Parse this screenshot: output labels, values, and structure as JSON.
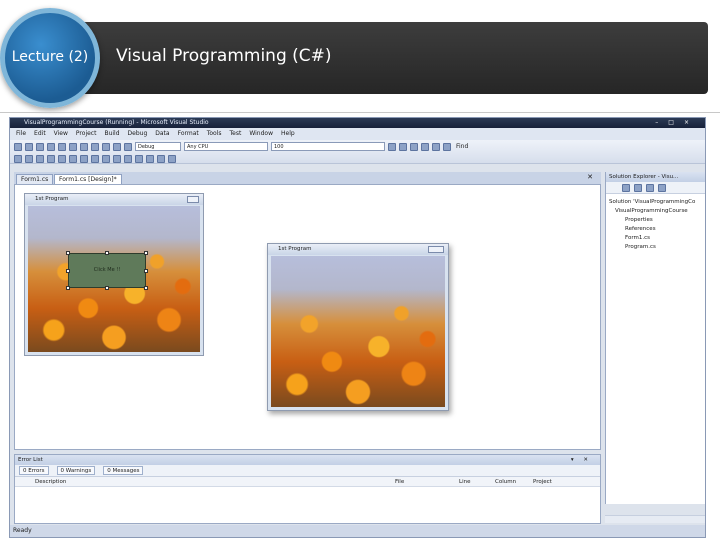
{
  "slide": {
    "lecture_label": "Lecture (2)",
    "title": "Visual Programming (C#)"
  },
  "window": {
    "title": "VisualProgrammingCourse (Running) - Microsoft Visual Studio",
    "controls": "–□×"
  },
  "menu": [
    "File",
    "Edit",
    "View",
    "Project",
    "Build",
    "Debug",
    "Data",
    "Format",
    "Tools",
    "Test",
    "Window",
    "Help"
  ],
  "toolbar": {
    "config": "Debug",
    "platform": "Any CPU",
    "find_value": "100",
    "zoom_label": "Find"
  },
  "tabs": {
    "code": "Form1.cs",
    "design": "Form1.cs [Design]*"
  },
  "designer_form": {
    "caption": "1st Program",
    "button_text": "Click Me !!"
  },
  "running_form": {
    "caption": "1st Program"
  },
  "solution_explorer": {
    "header": "Solution Explorer - Visu...",
    "items": [
      "Solution 'VisualProgrammingCo",
      "VisualProgrammingCourse",
      "Properties",
      "References",
      "Form1.cs",
      "Program.cs"
    ]
  },
  "error_list": {
    "header": "Error List",
    "tabs": [
      "0 Errors",
      "0 Warnings",
      "0 Messages"
    ],
    "columns": [
      "Description",
      "File",
      "Line",
      "Column",
      "Project"
    ]
  },
  "status": "Ready"
}
